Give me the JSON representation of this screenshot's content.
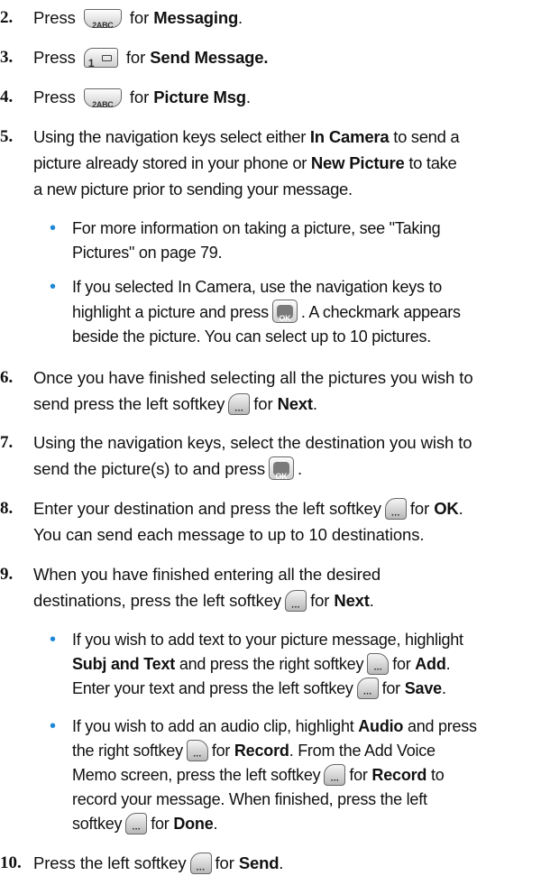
{
  "icons": {
    "key_2abc": "2ABC",
    "key_1msg": "1",
    "key_menu_ok": "OK",
    "softkey": "···"
  },
  "colors": {
    "bullet": "#1e88d6"
  },
  "steps": [
    {
      "num": "2.",
      "pre": "Press",
      "mid": "for",
      "bold": "Messaging",
      "end": "."
    },
    {
      "num": "3.",
      "pre": "Press",
      "mid": "for",
      "bold": "Send Message."
    },
    {
      "num": "4.",
      "pre": "Press",
      "mid": "for",
      "bold": "Picture Msg",
      "end": "."
    },
    {
      "num": "5.",
      "l1a": "Using the navigation keys select either ",
      "l1b": "In Camera",
      "l1c": " to send a",
      "l2a": "picture already stored in your phone or ",
      "l2b": "New Picture",
      "l2c": " to take",
      "l3": "a new picture prior to sending your message."
    },
    {
      "num": "6.",
      "l1": "Once you have finished selecting all the pictures you wish to",
      "l2a": "send press the left softkey",
      "l2b": "for",
      "l2c": "Next",
      "l2d": "."
    },
    {
      "num": "7.",
      "l1": "Using the navigation keys, select the destination you wish to",
      "l2a": "send the picture(s) to and press",
      "l2b": "."
    },
    {
      "num": "8.",
      "l1a": "Enter your destination and press the left softkey",
      "l1b": "for",
      "l1c": "OK",
      "l1d": ".",
      "l2": "You can send each message to up to 10 destinations."
    },
    {
      "num": "9.",
      "l1": " When you have finished entering all the desired",
      "l2a": "destinations, press the left softkey",
      "l2b": "for",
      "l2c": "Next",
      "l2d": "."
    },
    {
      "num": "10.",
      "pre": "Press the left softkey",
      "mid": "for",
      "bold": "Send",
      "end": "."
    }
  ],
  "bullets": [
    {
      "l1": "For more information on taking a picture, see \"Taking",
      "l2": "Pictures\" on page 79."
    },
    {
      "l1": "If you selected In Camera, use the navigation keys to",
      "l2a": "highlight a picture and press",
      "l2b": ". A checkmark appears",
      "l3": "beside the picture. You can select up to 10 pictures."
    },
    {
      "l1a": "If you wish to add text to your picture message, highlight",
      "l2a": "Subj and Text",
      "l2b": " and press the right softkey",
      "l2c": "for",
      "l2d": "Add",
      "l2e": ".",
      "l3a": "Enter your text and press the left softkey",
      "l3b": "for",
      "l3c": "Save",
      "l3d": "."
    },
    {
      "l1a": "If you wish to add an audio clip, highlight ",
      "l1b": "Audio",
      "l1c": " and press",
      "l2a": "the right softkey",
      "l2b": "for",
      "l2c": "Record",
      "l2d": ". From the Add Voice",
      "l3a": "Memo screen, press the left softkey",
      "l3b": "for",
      "l3c": "Record",
      "l3d": " to",
      "l4": "record your message. When finished, press the left",
      "l5a": "softkey",
      "l5b": "for",
      "l5c": "Done",
      "l5d": "."
    }
  ]
}
